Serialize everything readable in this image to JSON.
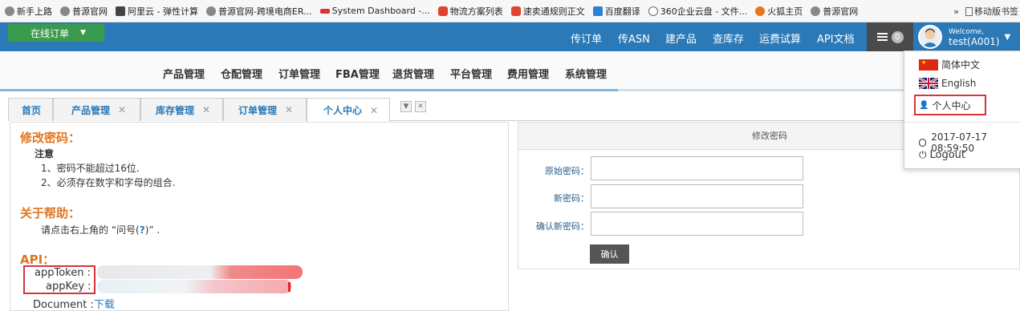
{
  "bookmarks": [
    {
      "label": "新手上路",
      "icon": "globe-icon"
    },
    {
      "label": "普源官网",
      "icon": "globe-icon"
    },
    {
      "label": "阿里云 - 弹性计算",
      "icon": "aliyun-icon"
    },
    {
      "label": "普源官网-跨境电商ER...",
      "icon": "globe-icon"
    },
    {
      "label": "System Dashboard -...",
      "icon": "system-icon"
    },
    {
      "label": "物流方案列表",
      "icon": "pocket-icon"
    },
    {
      "label": "速卖通规则正文",
      "icon": "pocket-icon"
    },
    {
      "label": "百度翻译",
      "icon": "translate-icon"
    },
    {
      "label": "360企业云盘 - 文件...",
      "icon": "cloud-icon"
    },
    {
      "label": "火狐主页",
      "icon": "firefox-icon"
    },
    {
      "label": "普源官网",
      "icon": "globe-icon"
    }
  ],
  "bookmarks_more": "»",
  "bookmarks_mobile": "移动版书签",
  "topbar": {
    "order_button": "在线订单",
    "links": [
      "传订单",
      "传ASN",
      "建产品",
      "查库存",
      "运费试算",
      "API文档"
    ],
    "message_count": "0",
    "welcome": "Welcome,",
    "username": "test(A001)"
  },
  "main_menu": [
    "产品管理",
    "仓配管理",
    "订单管理",
    "FBA管理",
    "退货管理",
    "平台管理",
    "费用管理",
    "系统管理"
  ],
  "tabs": [
    {
      "label": "首页",
      "closable": false
    },
    {
      "label": "产品管理",
      "closable": true
    },
    {
      "label": "库存管理",
      "closable": true
    },
    {
      "label": "订单管理",
      "closable": true
    },
    {
      "label": "个人中心",
      "closable": true,
      "active": true
    }
  ],
  "left": {
    "change_pwd_title": "修改密码：",
    "note_label": "注意",
    "note_1": "1、密码不能超过16位.",
    "note_2": "2、必须存在数字和字母的组合.",
    "help_title": "关于帮助：",
    "help_text_pre": "请点击右上角的 “问号(",
    "help_q": "?",
    "help_text_post": ")”  .",
    "api_title": "API：",
    "app_token_label": "appToken :",
    "app_key_label": "appKey :",
    "document_label": "Document :",
    "document_link": "下载"
  },
  "form": {
    "header": "修改密码",
    "old_password_label": "原始密码：",
    "new_password_label": "新密码：",
    "confirm_password_label": "确认新密码：",
    "submit": "确认"
  },
  "dropdown": {
    "lang_zh": "简体中文",
    "lang_en": "English",
    "profile": "个人中心",
    "last_login": "2017-07-17 08:59:50",
    "logout": "Logout"
  },
  "colors": {
    "topbar": "#2b79b6",
    "order_button": "#3a9b4e",
    "section_title": "#e0761f",
    "highlight_box": "#d9333a"
  }
}
